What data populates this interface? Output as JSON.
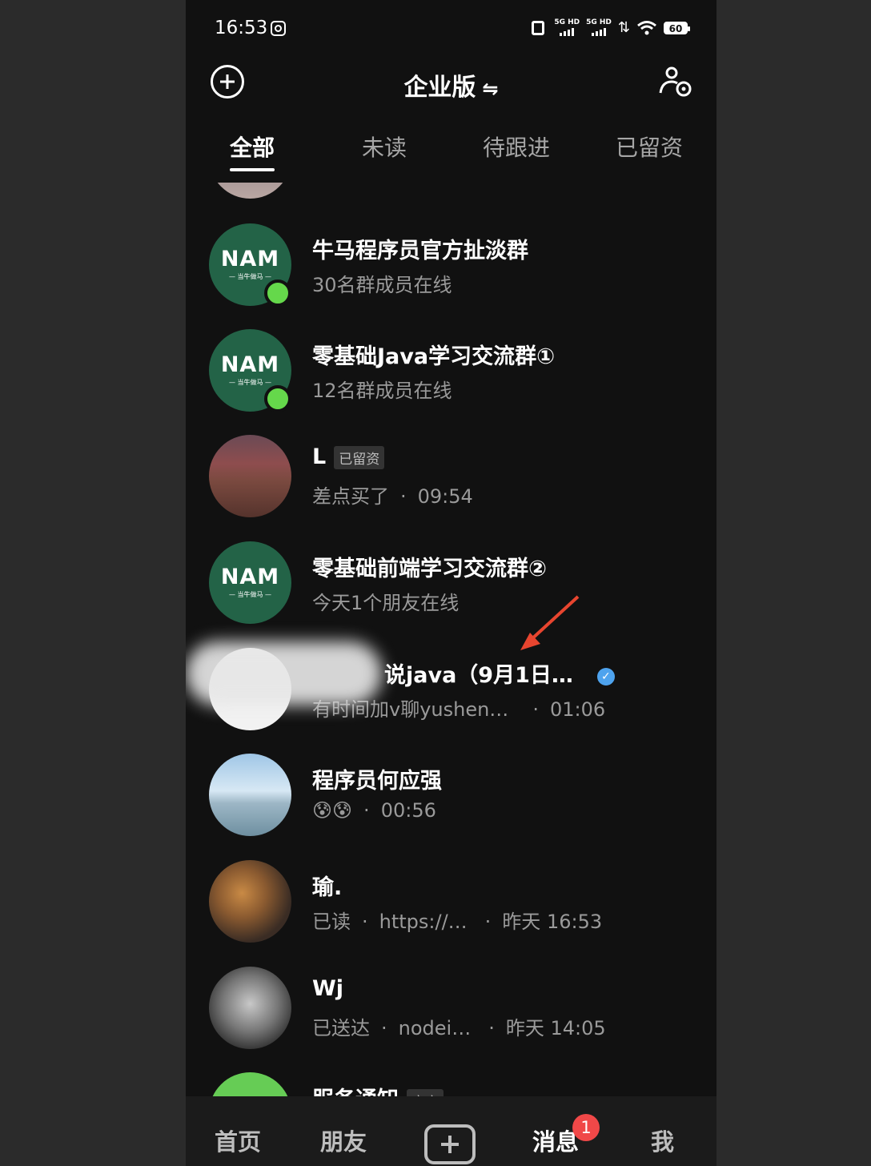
{
  "status_bar": {
    "time": "16:53",
    "battery": "60",
    "signal1": "5G HD",
    "signal2": "5G HD"
  },
  "header": {
    "title": "企业版",
    "swap_symbol": "⇋"
  },
  "tabs": [
    {
      "label": "全部"
    },
    {
      "label": "未读"
    },
    {
      "label": "待跟进"
    },
    {
      "label": "已留资"
    }
  ],
  "conversations": [
    {
      "title": "牛马程序员官方扯淡群",
      "subtitle": "30名群成员在线",
      "logo": "NAM",
      "logo_sub": "— 当牛做马 —"
    },
    {
      "title": "零基础Java学习交流群①",
      "subtitle": "12名群成员在线",
      "logo": "NAM",
      "logo_sub": "— 当牛做马 —"
    },
    {
      "title": "L",
      "tag": "已留资",
      "message": "差点买了",
      "time": "09:54"
    },
    {
      "title": "零基础前端学习交流群②",
      "subtitle": "今天1个朋友在线",
      "logo": "NAM",
      "logo_sub": "— 当牛做马 —"
    },
    {
      "title": "说java（9月1日…",
      "message": "有时间加v聊yushen…",
      "time": "01:06"
    },
    {
      "title": "程序员何应强",
      "message": "😰😰",
      "time": "00:56"
    },
    {
      "title": "瑜.",
      "status": "已读",
      "message": "https://…",
      "time": "昨天 16:53"
    },
    {
      "title": "Wj",
      "status": "已送达",
      "message": "nodei…",
      "time": "昨天 14:05"
    },
    {
      "title": "服务通知",
      "tag": "官方"
    }
  ],
  "bottom_nav": {
    "home": "首页",
    "friends": "朋友",
    "messages": "消息",
    "me": "我",
    "messages_badge": "1"
  },
  "colors": {
    "accent_green": "#65d84b",
    "badge_red": "#f04848",
    "verified_blue": "#4ea3ee"
  }
}
